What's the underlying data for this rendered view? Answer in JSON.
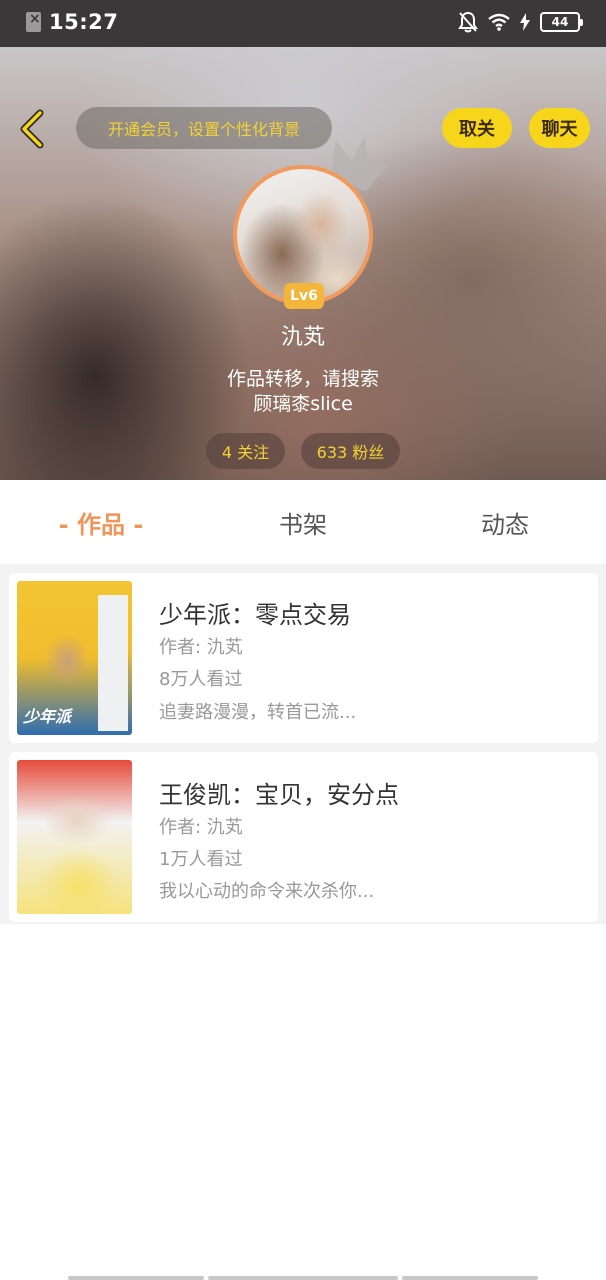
{
  "status_bar": {
    "time": "15:27",
    "battery": "44"
  },
  "header": {
    "vip_banner": "开通会员，设置个性化背景",
    "unfollow_label": "取关",
    "chat_label": "聊天",
    "level": "Lv6",
    "username": "氿芄",
    "bio_line1": "作品转移，请搜索",
    "bio_line2": "顾璃桼slice",
    "following": "4 关注",
    "fans": "633 粉丝"
  },
  "tabs": [
    {
      "label": "- 作品 -",
      "active": true
    },
    {
      "label": "书架",
      "active": false
    },
    {
      "label": "动态",
      "active": false
    }
  ],
  "works": [
    {
      "title": "少年派：零点交易",
      "author": "作者: 氿芄",
      "views": "8万人看过",
      "desc": "追妻路漫漫，转首已流...",
      "cover_text": "少年派"
    },
    {
      "title": "王俊凯：宝贝，安分点",
      "author": "作者: 氿芄",
      "views": "1万人看过",
      "desc": "我以心动的命令来次杀你..."
    }
  ],
  "colors": {
    "accent": "#f0955a",
    "pill_yellow": "#f7d51a",
    "status_bar": "#3a3838"
  }
}
